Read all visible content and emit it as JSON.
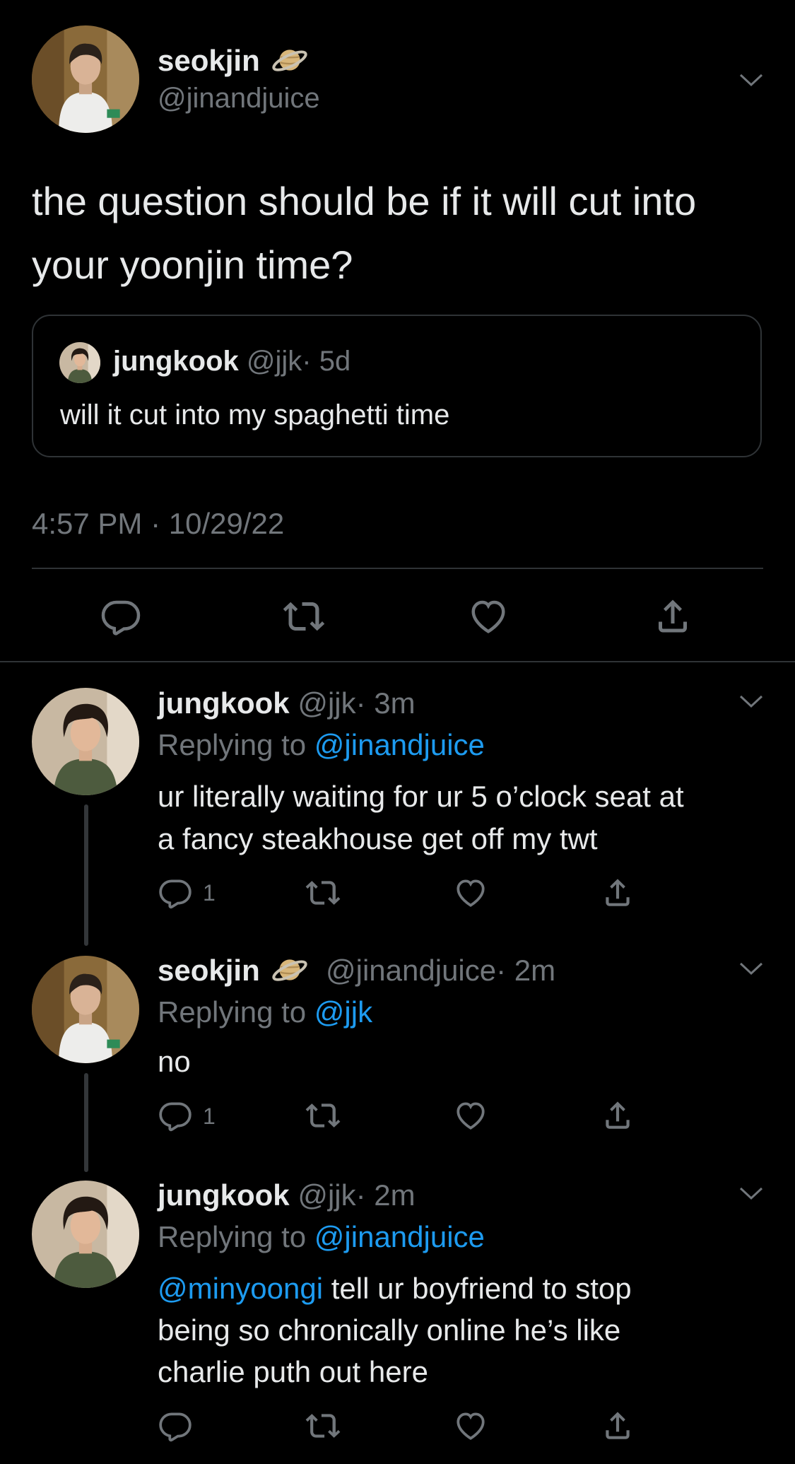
{
  "main_tweet": {
    "display_name": "seokjin",
    "handle": "@jinandjuice",
    "text_line1": "the question should be if it will cut into",
    "text_line2": "your yoonjin time?",
    "timestamp": "4:57 PM · 10/29/22",
    "quoted": {
      "display_name": "jungkook",
      "handle": "@jjk",
      "time": "· 5d",
      "text": "will it cut into my spaghetti time"
    }
  },
  "replies": [
    {
      "display_name": "jungkook",
      "handle": "@jjk",
      "time": "· 3m",
      "replying_prefix": "Replying to ",
      "replying_to": "@jinandjuice",
      "text_line1": "ur literally waiting for ur 5 o’clock seat at",
      "text_line2": "a fancy steakhouse get off my twt",
      "reply_count": "1"
    },
    {
      "display_name": "seokjin",
      "handle": "@jinandjuice",
      "time": "· 2m",
      "replying_prefix": "Replying to ",
      "replying_to": "@jjk",
      "text_line1": "no",
      "reply_count": "1"
    },
    {
      "display_name": "jungkook",
      "handle": "@jjk",
      "time": "· 2m",
      "replying_prefix": "Replying to ",
      "replying_to": "@jinandjuice",
      "mention": "@minyoongi",
      "text_line1_rest": " tell ur boyfriend to stop",
      "text_line2": "being so chronically online he’s like",
      "text_line3": "charlie puth out here"
    }
  ],
  "icons": {
    "badge": "saturn-emoji-icon",
    "reply": "reply-icon",
    "retweet": "retweet-icon",
    "like": "heart-icon",
    "share": "share-icon",
    "more": "chevron-down-icon"
  },
  "colors": {
    "background": "#000000",
    "text": "#e7e9ea",
    "muted": "#71767b",
    "link": "#1d9bf0",
    "divider": "#2f3336"
  }
}
